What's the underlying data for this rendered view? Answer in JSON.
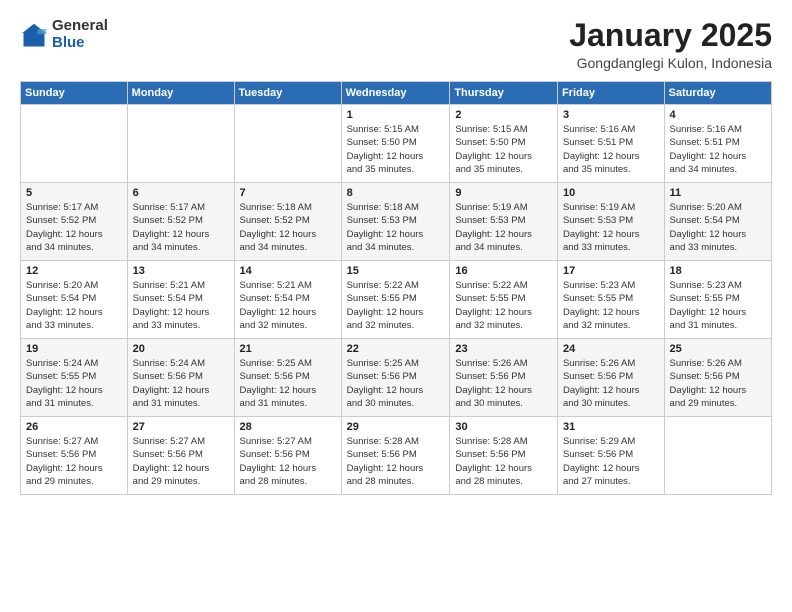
{
  "logo": {
    "general": "General",
    "blue": "Blue"
  },
  "header": {
    "month": "January 2025",
    "location": "Gongdanglegi Kulon, Indonesia"
  },
  "weekdays": [
    "Sunday",
    "Monday",
    "Tuesday",
    "Wednesday",
    "Thursday",
    "Friday",
    "Saturday"
  ],
  "weeks": [
    [
      {
        "day": "",
        "info": ""
      },
      {
        "day": "",
        "info": ""
      },
      {
        "day": "",
        "info": ""
      },
      {
        "day": "1",
        "info": "Sunrise: 5:15 AM\nSunset: 5:50 PM\nDaylight: 12 hours\nand 35 minutes."
      },
      {
        "day": "2",
        "info": "Sunrise: 5:15 AM\nSunset: 5:50 PM\nDaylight: 12 hours\nand 35 minutes."
      },
      {
        "day": "3",
        "info": "Sunrise: 5:16 AM\nSunset: 5:51 PM\nDaylight: 12 hours\nand 35 minutes."
      },
      {
        "day": "4",
        "info": "Sunrise: 5:16 AM\nSunset: 5:51 PM\nDaylight: 12 hours\nand 34 minutes."
      }
    ],
    [
      {
        "day": "5",
        "info": "Sunrise: 5:17 AM\nSunset: 5:52 PM\nDaylight: 12 hours\nand 34 minutes."
      },
      {
        "day": "6",
        "info": "Sunrise: 5:17 AM\nSunset: 5:52 PM\nDaylight: 12 hours\nand 34 minutes."
      },
      {
        "day": "7",
        "info": "Sunrise: 5:18 AM\nSunset: 5:52 PM\nDaylight: 12 hours\nand 34 minutes."
      },
      {
        "day": "8",
        "info": "Sunrise: 5:18 AM\nSunset: 5:53 PM\nDaylight: 12 hours\nand 34 minutes."
      },
      {
        "day": "9",
        "info": "Sunrise: 5:19 AM\nSunset: 5:53 PM\nDaylight: 12 hours\nand 34 minutes."
      },
      {
        "day": "10",
        "info": "Sunrise: 5:19 AM\nSunset: 5:53 PM\nDaylight: 12 hours\nand 33 minutes."
      },
      {
        "day": "11",
        "info": "Sunrise: 5:20 AM\nSunset: 5:54 PM\nDaylight: 12 hours\nand 33 minutes."
      }
    ],
    [
      {
        "day": "12",
        "info": "Sunrise: 5:20 AM\nSunset: 5:54 PM\nDaylight: 12 hours\nand 33 minutes."
      },
      {
        "day": "13",
        "info": "Sunrise: 5:21 AM\nSunset: 5:54 PM\nDaylight: 12 hours\nand 33 minutes."
      },
      {
        "day": "14",
        "info": "Sunrise: 5:21 AM\nSunset: 5:54 PM\nDaylight: 12 hours\nand 32 minutes."
      },
      {
        "day": "15",
        "info": "Sunrise: 5:22 AM\nSunset: 5:55 PM\nDaylight: 12 hours\nand 32 minutes."
      },
      {
        "day": "16",
        "info": "Sunrise: 5:22 AM\nSunset: 5:55 PM\nDaylight: 12 hours\nand 32 minutes."
      },
      {
        "day": "17",
        "info": "Sunrise: 5:23 AM\nSunset: 5:55 PM\nDaylight: 12 hours\nand 32 minutes."
      },
      {
        "day": "18",
        "info": "Sunrise: 5:23 AM\nSunset: 5:55 PM\nDaylight: 12 hours\nand 31 minutes."
      }
    ],
    [
      {
        "day": "19",
        "info": "Sunrise: 5:24 AM\nSunset: 5:55 PM\nDaylight: 12 hours\nand 31 minutes."
      },
      {
        "day": "20",
        "info": "Sunrise: 5:24 AM\nSunset: 5:56 PM\nDaylight: 12 hours\nand 31 minutes."
      },
      {
        "day": "21",
        "info": "Sunrise: 5:25 AM\nSunset: 5:56 PM\nDaylight: 12 hours\nand 31 minutes."
      },
      {
        "day": "22",
        "info": "Sunrise: 5:25 AM\nSunset: 5:56 PM\nDaylight: 12 hours\nand 30 minutes."
      },
      {
        "day": "23",
        "info": "Sunrise: 5:26 AM\nSunset: 5:56 PM\nDaylight: 12 hours\nand 30 minutes."
      },
      {
        "day": "24",
        "info": "Sunrise: 5:26 AM\nSunset: 5:56 PM\nDaylight: 12 hours\nand 30 minutes."
      },
      {
        "day": "25",
        "info": "Sunrise: 5:26 AM\nSunset: 5:56 PM\nDaylight: 12 hours\nand 29 minutes."
      }
    ],
    [
      {
        "day": "26",
        "info": "Sunrise: 5:27 AM\nSunset: 5:56 PM\nDaylight: 12 hours\nand 29 minutes."
      },
      {
        "day": "27",
        "info": "Sunrise: 5:27 AM\nSunset: 5:56 PM\nDaylight: 12 hours\nand 29 minutes."
      },
      {
        "day": "28",
        "info": "Sunrise: 5:27 AM\nSunset: 5:56 PM\nDaylight: 12 hours\nand 28 minutes."
      },
      {
        "day": "29",
        "info": "Sunrise: 5:28 AM\nSunset: 5:56 PM\nDaylight: 12 hours\nand 28 minutes."
      },
      {
        "day": "30",
        "info": "Sunrise: 5:28 AM\nSunset: 5:56 PM\nDaylight: 12 hours\nand 28 minutes."
      },
      {
        "day": "31",
        "info": "Sunrise: 5:29 AM\nSunset: 5:56 PM\nDaylight: 12 hours\nand 27 minutes."
      },
      {
        "day": "",
        "info": ""
      }
    ]
  ]
}
